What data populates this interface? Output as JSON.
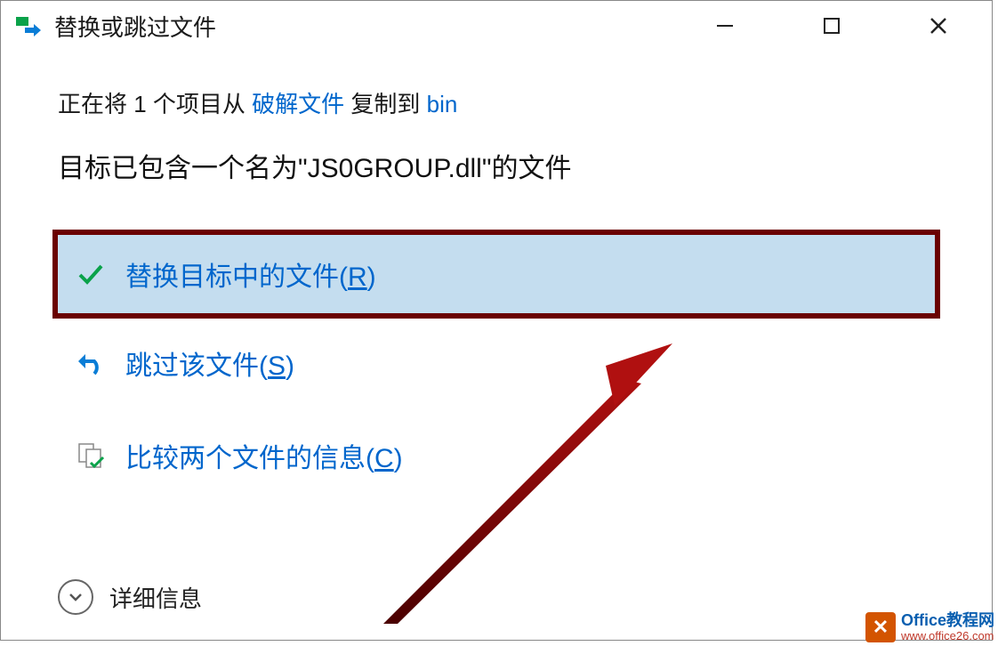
{
  "titlebar": {
    "title": "替换或跳过文件"
  },
  "body": {
    "copy_prefix": "正在将 1 个项目从 ",
    "copy_source": "破解文件",
    "copy_mid": " 复制到 ",
    "copy_dest": "bin",
    "conflict": "目标已包含一个名为\"JS0GROUP.dll\"的文件"
  },
  "options": {
    "replace": {
      "label": "替换目标中的文件(",
      "hotkey": "R",
      "suffix": ")"
    },
    "skip": {
      "label": "跳过该文件(",
      "hotkey": "S",
      "suffix": ")"
    },
    "compare": {
      "label": "比较两个文件的信息(",
      "hotkey": "C",
      "suffix": ")"
    }
  },
  "details": {
    "label": "详细信息"
  },
  "watermark": {
    "line1": "Office教程网",
    "line2": "www.office26.com"
  }
}
